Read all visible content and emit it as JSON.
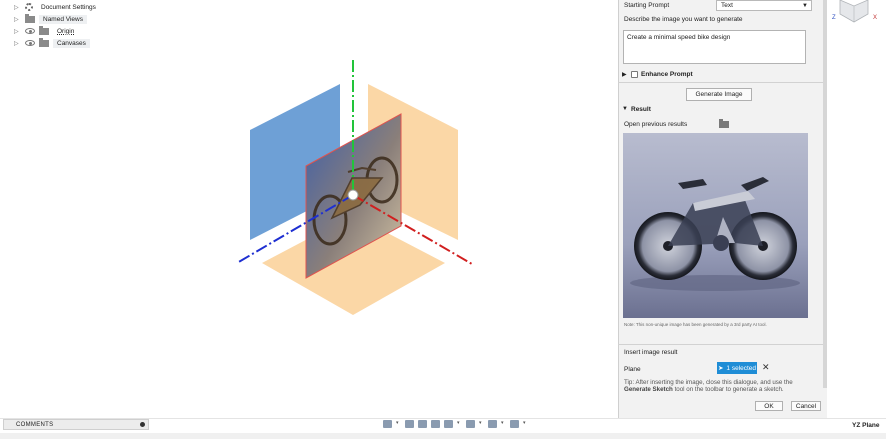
{
  "browser": {
    "items": [
      {
        "label": "Document Settings",
        "icon": "gear-icon"
      },
      {
        "label": "Named Views",
        "icon": "folder-icon"
      },
      {
        "label": "Origin",
        "icon": "folder-icon"
      },
      {
        "label": "Canvases",
        "icon": "folder-icon"
      }
    ]
  },
  "panel": {
    "starting_prompt_label": "Starting Prompt",
    "starting_prompt_value": "Text",
    "describe_label": "Describe the image you want to generate",
    "prompt_text": "Create a minimal speed bike design",
    "enhance_label": "Enhance Prompt",
    "generate_button": "Generate Image",
    "result_label": "Result",
    "open_previous": "Open previous results",
    "note": "Note: This non-unique image has been generated by a 3rd party AI tool.",
    "insert_label": "Insert image result",
    "plane_label": "Plane",
    "selected_label": "1 selected",
    "close_symbol": "✕",
    "tip_prefix": "Tip: After inserting the image, close this dialogue, and use the",
    "tip_bold": "Generate Sketch",
    "tip_suffix": "tool on the toolbar to generate a sketch.",
    "ok_button": "OK",
    "cancel_button": "Cancel"
  },
  "viewcube": {
    "z": "Z",
    "x": "X"
  },
  "bottom": {
    "comments_label": "COMMENTS",
    "active_plane": "YZ Plane"
  },
  "colors": {
    "accent": "#1f8dd6",
    "y_axis": "#22c43a",
    "x_axis": "#d11f1f",
    "z_axis": "#1e2fd1",
    "plane_blue": "#6ea0d6",
    "plane_orange": "#fbd7a6"
  }
}
